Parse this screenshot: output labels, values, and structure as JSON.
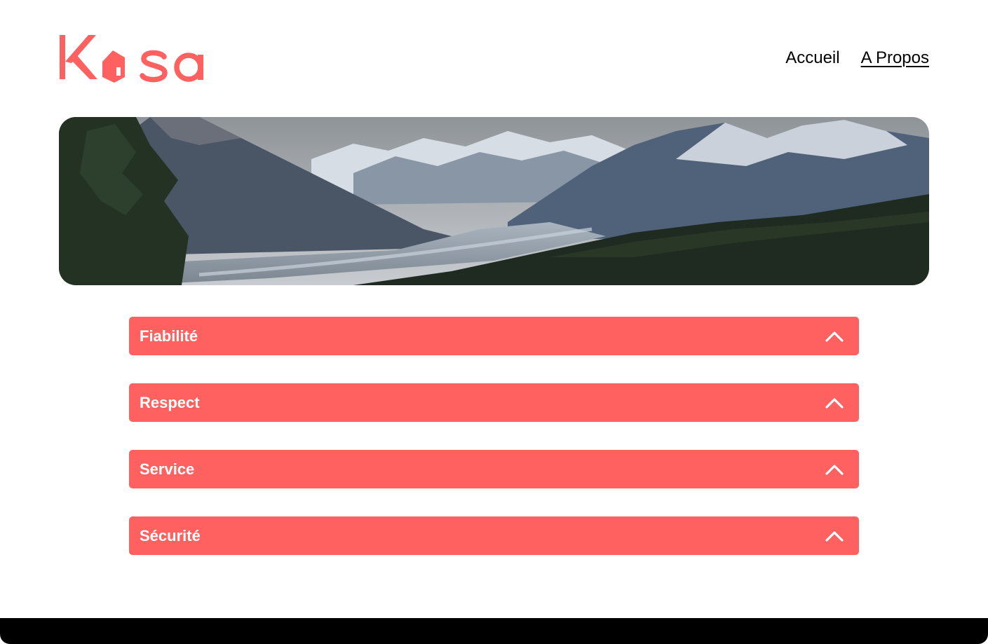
{
  "brand": {
    "logo_text": "Kasa",
    "color": "#FF6060"
  },
  "nav": {
    "items": [
      {
        "label": "Accueil",
        "active": false
      },
      {
        "label": "A Propos",
        "active": true
      }
    ]
  },
  "banner": {
    "image": "mountain-valley-landscape"
  },
  "collapses": [
    {
      "title": "Fiabilité",
      "icon": "chevron-up-icon"
    },
    {
      "title": "Respect",
      "icon": "chevron-up-icon"
    },
    {
      "title": "Service",
      "icon": "chevron-up-icon"
    },
    {
      "title": "Sécurité",
      "icon": "chevron-up-icon"
    }
  ],
  "colors": {
    "accent": "#FF6060",
    "footer": "#000000",
    "text": "#000000"
  }
}
